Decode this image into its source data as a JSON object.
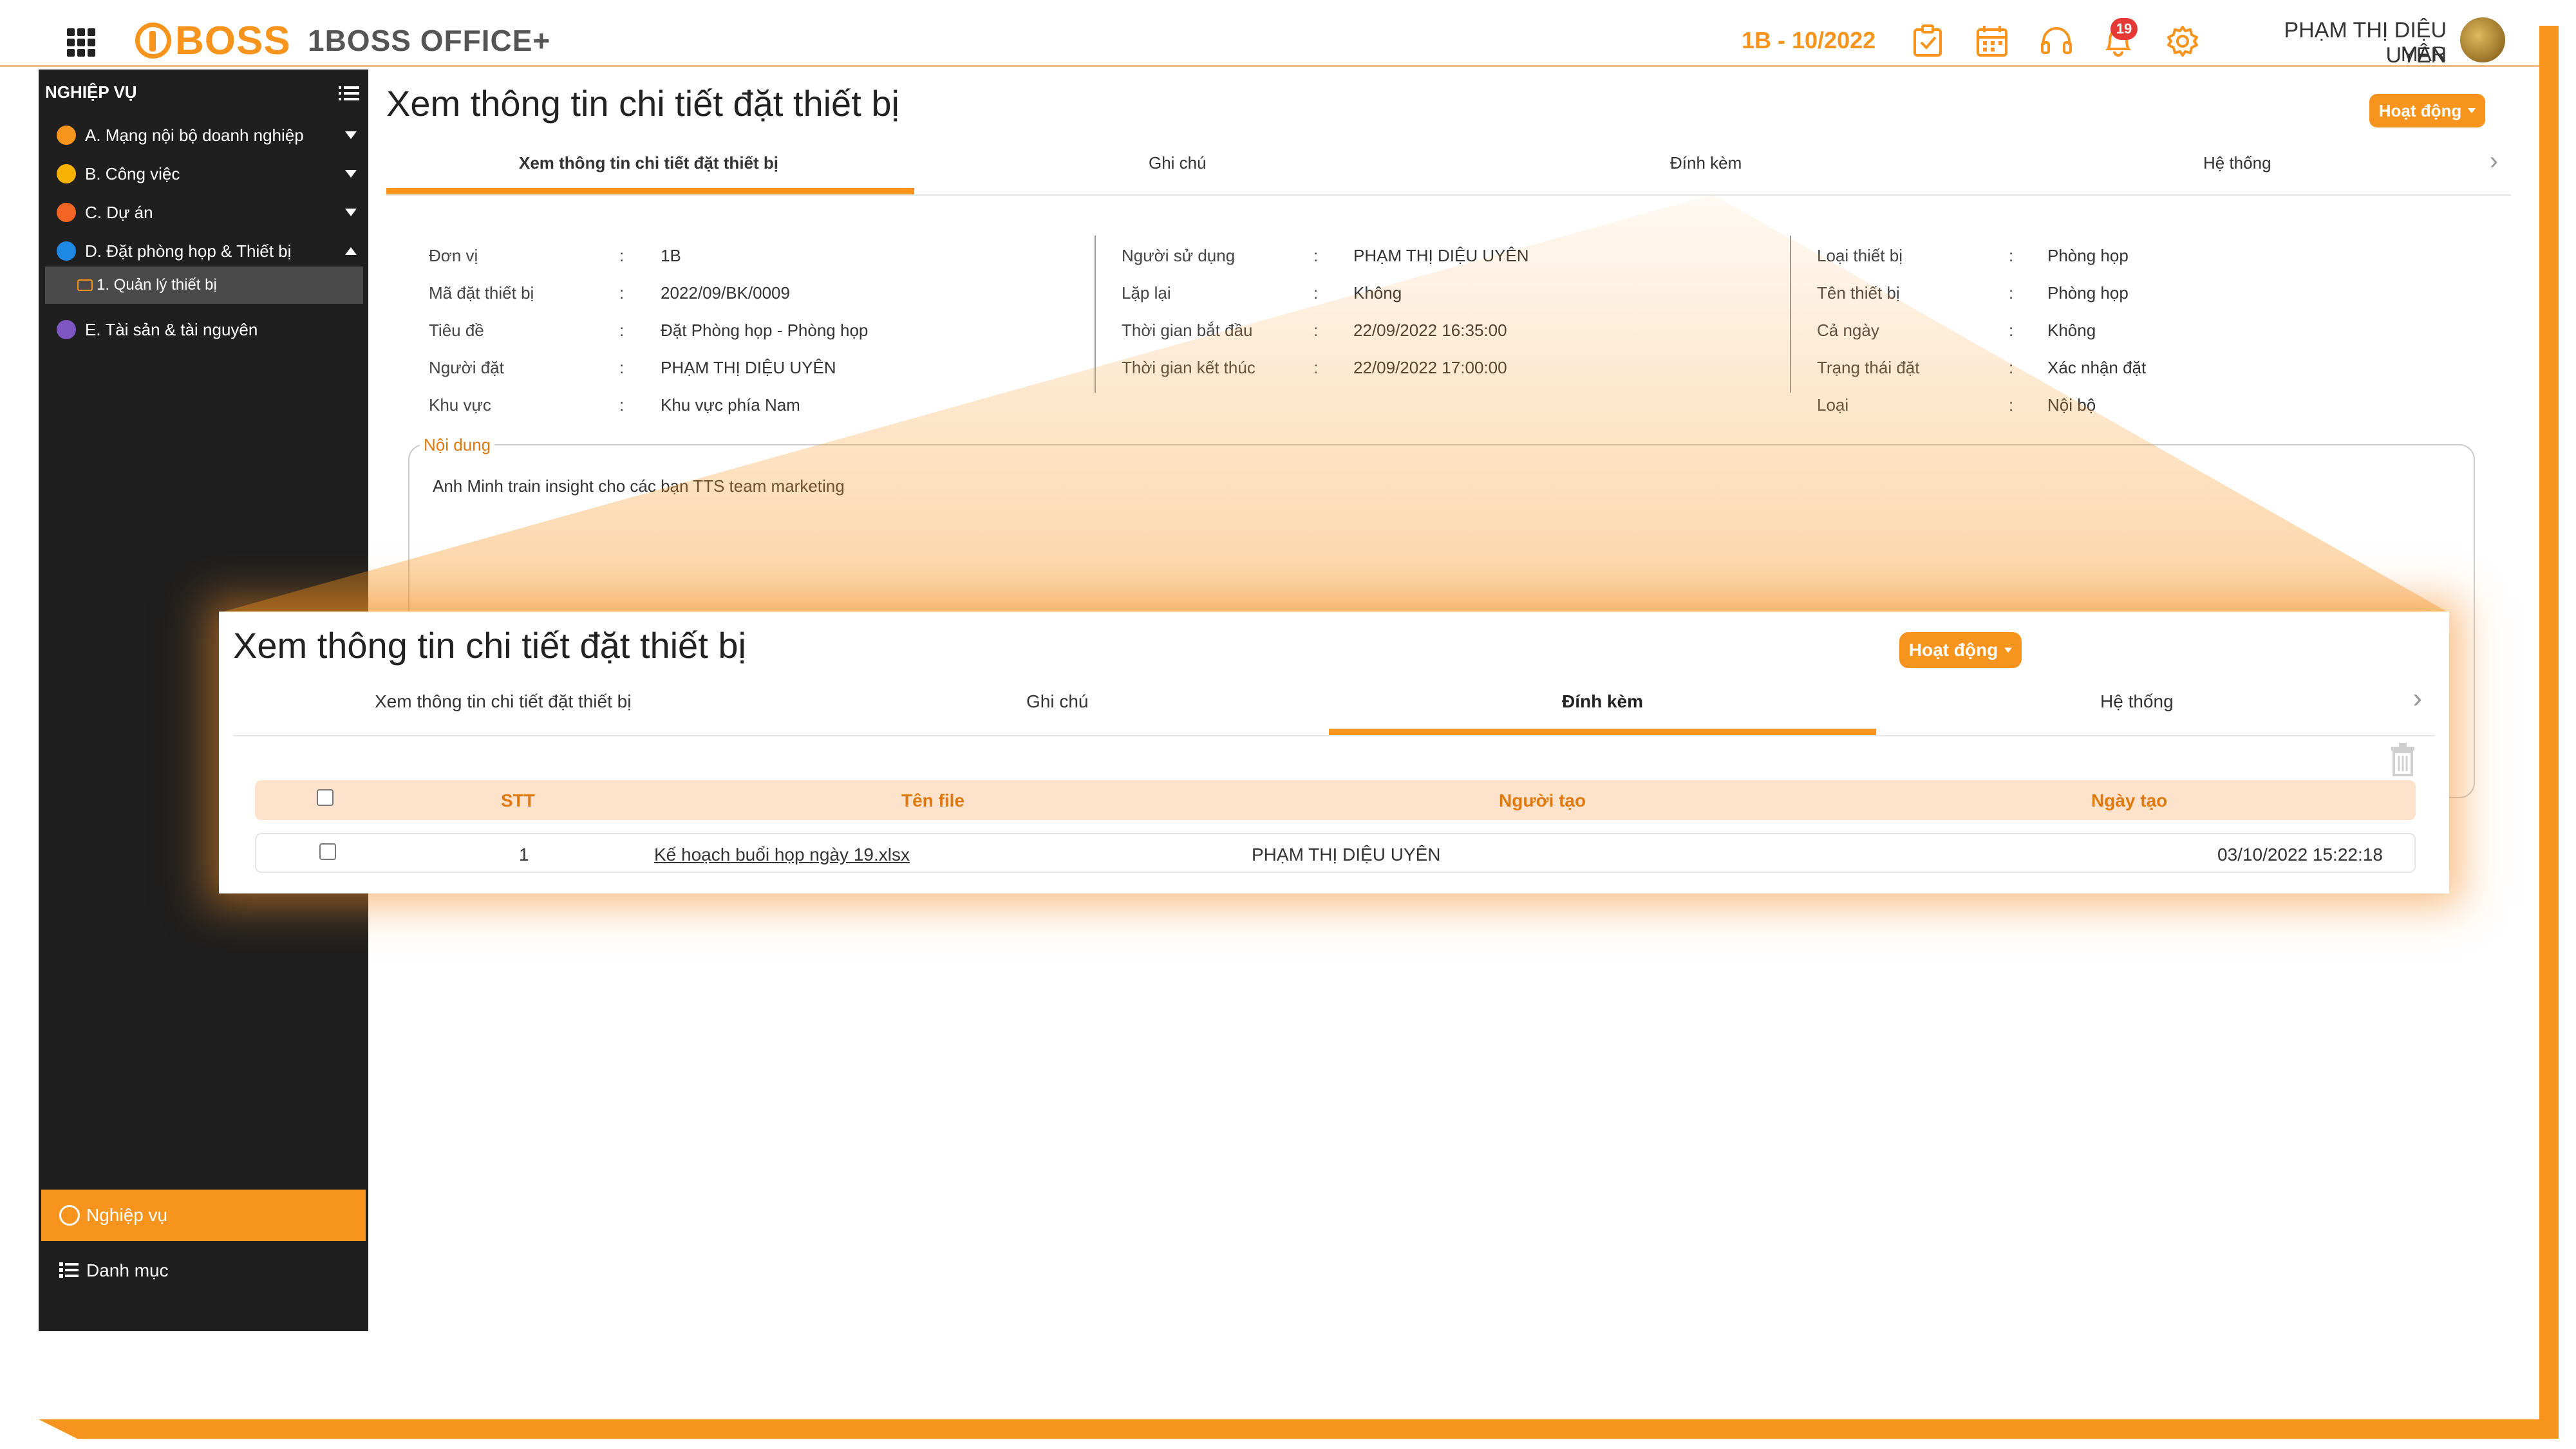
{
  "header": {
    "logo_text": "BOSS",
    "app_title": "1BOSS OFFICE+",
    "period": "1B - 10/2022",
    "notification_count": "19",
    "user_name": "PHẠM THỊ DIỆU UYÊN",
    "user_dept": "MAR",
    "icons": [
      "apps-grid-icon",
      "task-check-icon",
      "calendar-icon",
      "headset-icon",
      "bell-icon",
      "gear-icon"
    ]
  },
  "sidebar": {
    "header": "NGHIỆP VỤ",
    "items": [
      {
        "label": "A. Mạng nội bộ doanh nghiệp",
        "color": "#f7941d",
        "caret": "down"
      },
      {
        "label": "B. Công việc",
        "color": "#f5b300",
        "caret": "down"
      },
      {
        "label": "C. Dự án",
        "color": "#f26522",
        "caret": "down"
      },
      {
        "label": "D. Đặt phòng họp & Thiết bị",
        "color": "#1e88e5",
        "caret": "up"
      },
      {
        "label": "E. Tài sản & tài nguyên",
        "color": "#7e57c2",
        "caret": ""
      }
    ],
    "sub_item": "1. Quản lý thiết bị",
    "bottom": {
      "active": "Nghiệp vụ",
      "other": "Danh mục"
    }
  },
  "main": {
    "title": "Xem thông tin chi tiết đặt thiết bị",
    "action_button": "Hoạt động",
    "tabs": [
      "Xem thông tin chi tiết đặt thiết bị",
      "Ghi chú",
      "Đính kèm",
      "Hệ thống"
    ],
    "col1": [
      {
        "label": "Đơn vị",
        "value": "1B"
      },
      {
        "label": "Mã đặt thiết bị",
        "value": "2022/09/BK/0009"
      },
      {
        "label": "Tiêu đề",
        "value": "Đặt Phòng họp - Phòng họp"
      },
      {
        "label": "Người đặt",
        "value": "PHẠM THỊ DIỆU UYÊN"
      },
      {
        "label": "Khu vực",
        "value": "Khu vực phía Nam"
      }
    ],
    "col2": [
      {
        "label": "Người sử dụng",
        "value": "PHẠM THỊ DIỆU UYÊN"
      },
      {
        "label": "Lặp lại",
        "value": "Không"
      },
      {
        "label": "Thời gian bắt đầu",
        "value": "22/09/2022 16:35:00"
      },
      {
        "label": "Thời gian kết thúc",
        "value": "22/09/2022 17:00:00"
      }
    ],
    "col3": [
      {
        "label": "Loại thiết bị",
        "value": "Phòng họp"
      },
      {
        "label": "Tên thiết bị",
        "value": "Phòng họp"
      },
      {
        "label": "Cả ngày",
        "value": "Không"
      },
      {
        "label": "Trạng thái đặt",
        "value": "Xác nhận đặt"
      },
      {
        "label": "Loại",
        "value": "Nội bộ"
      }
    ],
    "colon": ":",
    "content_legend": "Nội dung",
    "content_text": "Anh Minh train insight cho các bạn TTS team marketing"
  },
  "zoom": {
    "title": "Xem thông tin chi tiết đặt thiết bị",
    "action_button": "Hoạt động",
    "tabs": [
      "Xem thông tin chi tiết đặt thiết bị",
      "Ghi chú",
      "Đính kèm",
      "Hệ thống"
    ],
    "active_tab": "Đính kèm",
    "table": {
      "headers": [
        "STT",
        "Tên file",
        "Người tạo",
        "Ngày tạo"
      ],
      "rows": [
        {
          "stt": "1",
          "file": "Kế hoạch buổi họp ngày 19.xlsx",
          "creator": "PHẠM THỊ DIỆU UYÊN",
          "date": "03/10/2022 15:22:18"
        }
      ]
    }
  },
  "colors": {
    "accent": "#f7941d",
    "sidebar_bg": "#1f1f1f",
    "table_header_bg": "#fde3cc"
  }
}
